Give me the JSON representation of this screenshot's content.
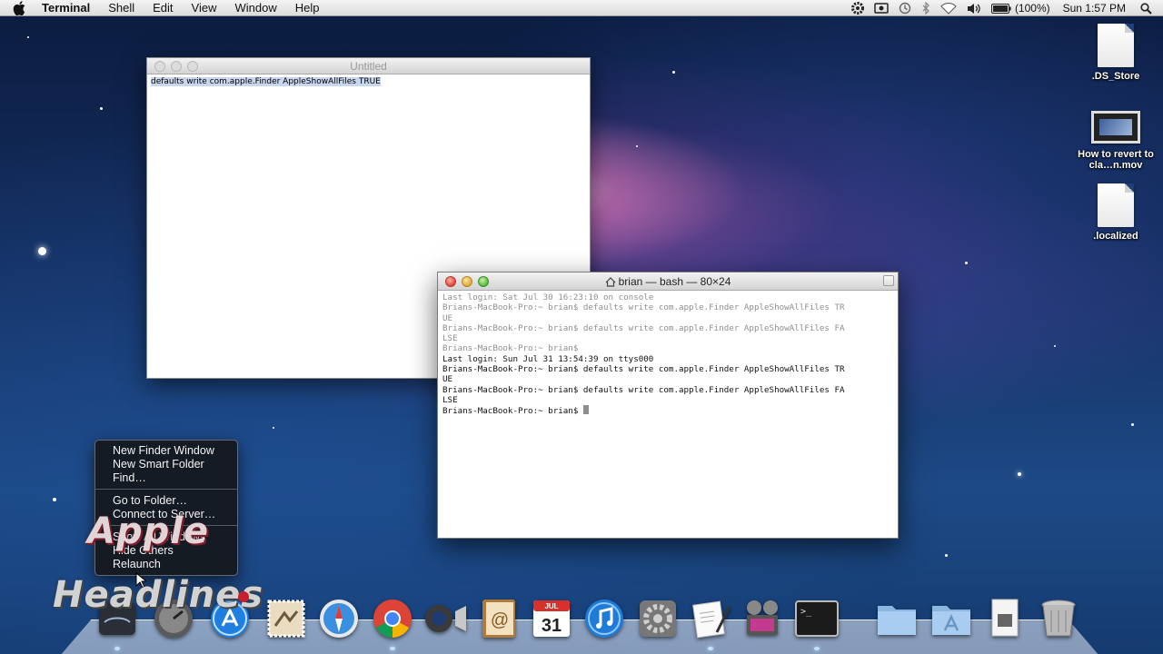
{
  "menubar": {
    "app_name": "Terminal",
    "items": [
      "Shell",
      "Edit",
      "View",
      "Window",
      "Help"
    ],
    "battery": "(100%)",
    "clock": "Sun 1:57 PM"
  },
  "textedit": {
    "title": "Untitled",
    "content": "defaults write com.apple.Finder AppleShowAllFiles TRUE"
  },
  "terminal": {
    "title": "brian — bash — 80×24",
    "old_lines": [
      "Last login: Sat Jul 30 16:23:10 on console",
      "Brians-MacBook-Pro:~ brian$ defaults write com.apple.Finder AppleShowAllFiles TR",
      "UE",
      "Brians-MacBook-Pro:~ brian$ defaults write com.apple.Finder AppleShowAllFiles FA",
      "LSE",
      "Brians-MacBook-Pro:~ brian$"
    ],
    "new_lines": [
      "Last login: Sun Jul 31 13:54:39 on ttys000",
      "Brians-MacBook-Pro:~ brian$ defaults write com.apple.Finder AppleShowAllFiles TR",
      "UE",
      "Brians-MacBook-Pro:~ brian$ defaults write com.apple.Finder AppleShowAllFiles FA",
      "LSE"
    ],
    "prompt": "Brians-MacBook-Pro:~ brian$ "
  },
  "desktop_icons": {
    "ds_store": ".DS_Store",
    "movie": "How to revert to cla…n.mov",
    "localized": ".localized"
  },
  "context_menu": {
    "group1": [
      "New Finder Window",
      "New Smart Folder",
      "Find…"
    ],
    "group2": [
      "Go to Folder…",
      "Connect to Server…"
    ],
    "group3": [
      "Show All Windows",
      "Hide Others",
      "Relaunch"
    ]
  },
  "watermark": {
    "line1": "Apple",
    "line2": "Headlines"
  },
  "dock": {
    "calendar_month": "JUL",
    "calendar_day": "31"
  },
  "colors": {
    "selection": "#c8d6ee",
    "menu_bg": "#141416"
  }
}
